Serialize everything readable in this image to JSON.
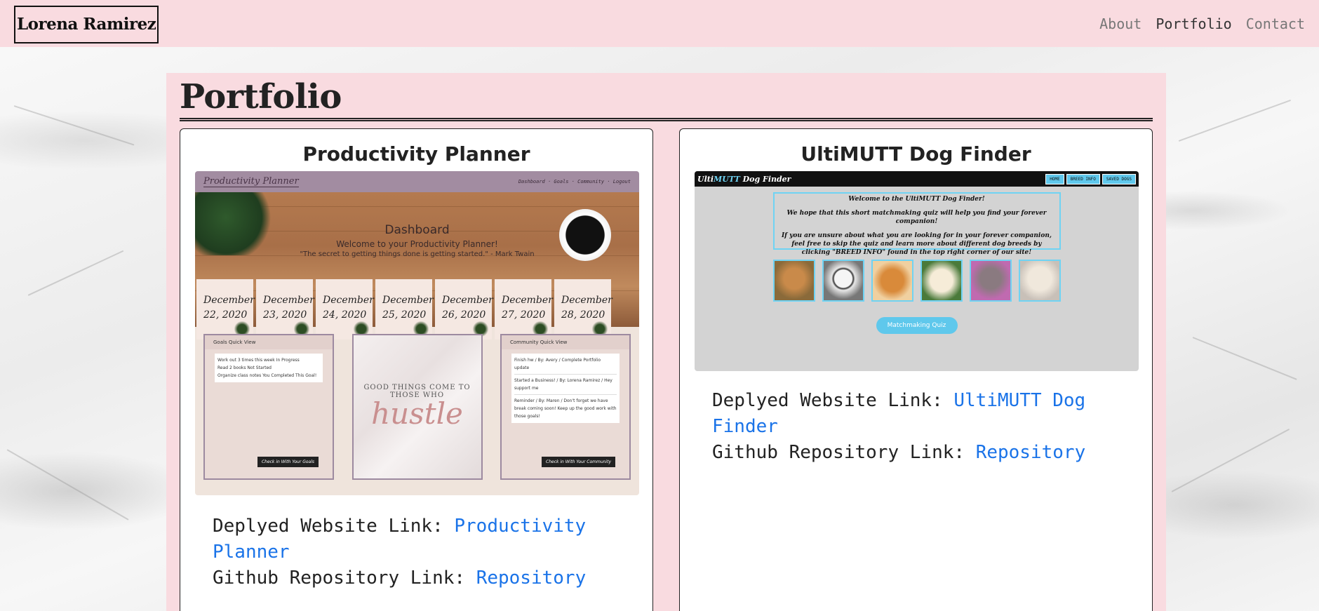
{
  "colors": {
    "pink": "#f9dbe0",
    "link": "#1a73e8"
  },
  "nav": {
    "brand": "Lorena Ramirez",
    "links": [
      {
        "label": "About",
        "active": false
      },
      {
        "label": "Portfolio",
        "active": true
      },
      {
        "label": "Contact",
        "active": false
      }
    ]
  },
  "page": {
    "title": "Portfolio"
  },
  "projects": [
    {
      "title": "Productivity Planner",
      "deployed_prefix": "Deplyed Website Link: ",
      "deployed_link": "Productivity Planner",
      "repo_prefix": "Github Repository Link: ",
      "repo_link": "Repository",
      "screenshot": {
        "brand": "Productivity Planner",
        "menu": "Dashboard · Goals · Community · Logout",
        "heading": "Dashboard",
        "welcome": "Welcome to your Productivity Planner!",
        "quote": "\"The secret to getting things done is getting started.\" - Mark Twain",
        "days": [
          "December 22, 2020",
          "December 23, 2020",
          "December 24, 2020",
          "December 25, 2020",
          "December 26, 2020",
          "December 27, 2020",
          "December 28, 2020"
        ],
        "goals_header": "Goals Quick View",
        "goals": [
          "Work out 3 times this week      In Progress",
          "Read 2 books          Not Started",
          "Organize class notes   You Completed This Goal!"
        ],
        "goals_button": "Check in With Your Goals",
        "center_text": "GOOD THINGS COME TO THOSE WHO",
        "center_script": "hustle",
        "community_header": "Community Quick View",
        "community": [
          "Finish hw / By: Avery / Complete Portfolio update",
          "Started a Business! / By: Lorena Ramirez / Hey support me",
          "Reminder / By: Maren / Don't forget we have break coming soon! Keep up the good work with those goals!"
        ],
        "community_button": "Check in With Your Community"
      }
    },
    {
      "title": "UltiMUTT Dog Finder",
      "deployed_prefix": "Deplyed Website Link: ",
      "deployed_link": "UltiMUTT Dog Finder",
      "repo_prefix": "Github Repository Link: ",
      "repo_link": "Repository",
      "screenshot": {
        "brand_a": "Ulti",
        "brand_b": "MUTT",
        "brand_c": " Dog Finder",
        "buttons": [
          "HOME",
          "BREED INFO",
          "SAVED DOGS"
        ],
        "welcome": "Welcome to the UltiMUTT Dog Finder!",
        "line1": "We hope that this short matchmaking quiz will help you find your forever companion!",
        "line2": "If you are unsure about what you are looking for in your forever companion, feel free to skip the quiz and learn more about different dog breeds by clicking \"BREED INFO\" found in the top right corner of our site!",
        "dog_colors": [
          "#c98a4a",
          "#e8e8e8",
          "#d98a3a",
          "#f0e2c6",
          "#8a7a80",
          "#e8e0d4"
        ],
        "quiz_button": "Matchmaking Quiz"
      }
    }
  ]
}
